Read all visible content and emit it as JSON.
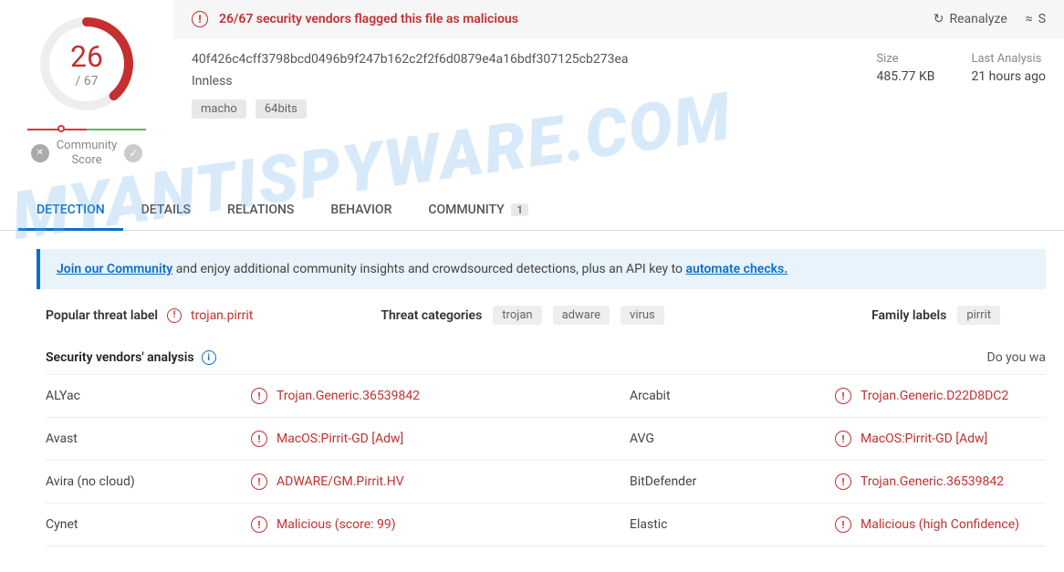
{
  "score": {
    "num": "26",
    "total": "/ 67"
  },
  "community_score_label": "Community\nScore",
  "alert": {
    "text": "26/67 security vendors flagged this file as malicious",
    "reanalyze": "Reanalyze",
    "similar": "S"
  },
  "file": {
    "hash": "40f426c4cff3798bcd0496b9f247b162c2f2f6d0879e4a16bdf307125cb273ea",
    "name": "Innless",
    "tags": [
      "macho",
      "64bits"
    ],
    "size_label": "Size",
    "size_value": "485.77 KB",
    "last_label": "Last Analysis",
    "last_value": "21 hours ago"
  },
  "tabs": {
    "detection": "DETECTION",
    "details": "DETAILS",
    "relations": "RELATIONS",
    "behavior": "BEHAVIOR",
    "community": "COMMUNITY",
    "community_count": "1"
  },
  "banner": {
    "join": "Join our Community",
    "mid": " and enjoy additional community insights and crowdsourced detections, plus an API key to ",
    "auto": "automate checks."
  },
  "threat": {
    "popular_label": "Popular threat label",
    "popular_value": "trojan.pirrit",
    "cat_label": "Threat categories",
    "cats": [
      "trojan",
      "adware",
      "virus"
    ],
    "family_label": "Family labels",
    "families": [
      "pirrit"
    ]
  },
  "analysis": {
    "title": "Security vendors' analysis",
    "right": "Do you wa"
  },
  "vendors": [
    {
      "n1": "ALYac",
      "d1": "Trojan.Generic.36539842",
      "n2": "Arcabit",
      "d2": "Trojan.Generic.D22D8DC2"
    },
    {
      "n1": "Avast",
      "d1": "MacOS:Pirrit-GD [Adw]",
      "n2": "AVG",
      "d2": "MacOS:Pirrit-GD [Adw]"
    },
    {
      "n1": "Avira (no cloud)",
      "d1": "ADWARE/GM.Pirrit.HV",
      "n2": "BitDefender",
      "d2": "Trojan.Generic.36539842"
    },
    {
      "n1": "Cynet",
      "d1": "Malicious (score: 99)",
      "n2": "Elastic",
      "d2": "Malicious (high Confidence)"
    }
  ],
  "watermark": "MYANTISPYWARE.COM"
}
